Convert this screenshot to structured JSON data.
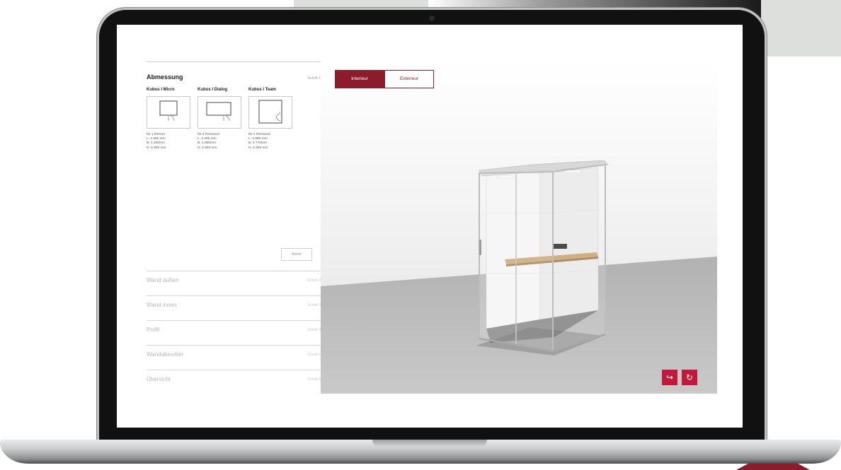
{
  "viewer": {
    "tabs": [
      {
        "label": "Interieur",
        "active": true
      },
      {
        "label": "Exterieur",
        "active": false
      }
    ],
    "share_icon": "share-icon",
    "rotate_icon": "rotate-icon"
  },
  "configurator": {
    "current_step": {
      "title": "Abmessung",
      "step_label": "Schritt 1",
      "variants": [
        {
          "name": "Kubus I Micro",
          "specs": [
            "für 1 Person",
            "L: 1.500 mm",
            "B: 1.200mm",
            "H: 2.300 mm"
          ]
        },
        {
          "name": "Kubus I Dialog",
          "specs": [
            "für 2 Personen",
            "L: 2.200 mm",
            "B: 1.080mm",
            "H: 2.300 mm"
          ]
        },
        {
          "name": "Kubus I Team",
          "specs": [
            "für 4 Personen",
            "L: 2.680 mm",
            "B: 2.770mm",
            "H: 2.300 mm"
          ]
        }
      ],
      "next_button": "Weiter"
    },
    "collapsed_steps": [
      {
        "label": "Wand außen",
        "step_label": "Schritt 2"
      },
      {
        "label": "Wand innen",
        "step_label": "Schritt 3"
      },
      {
        "label": "Profil",
        "step_label": "Schritt 4"
      },
      {
        "label": "Wandabsorber",
        "step_label": "Schritt 5"
      },
      {
        "label": "Übersicht",
        "step_label": "Schritt 6"
      }
    ]
  },
  "colors": {
    "accent": "#8c1c2c",
    "button_red": "#c2183a"
  }
}
